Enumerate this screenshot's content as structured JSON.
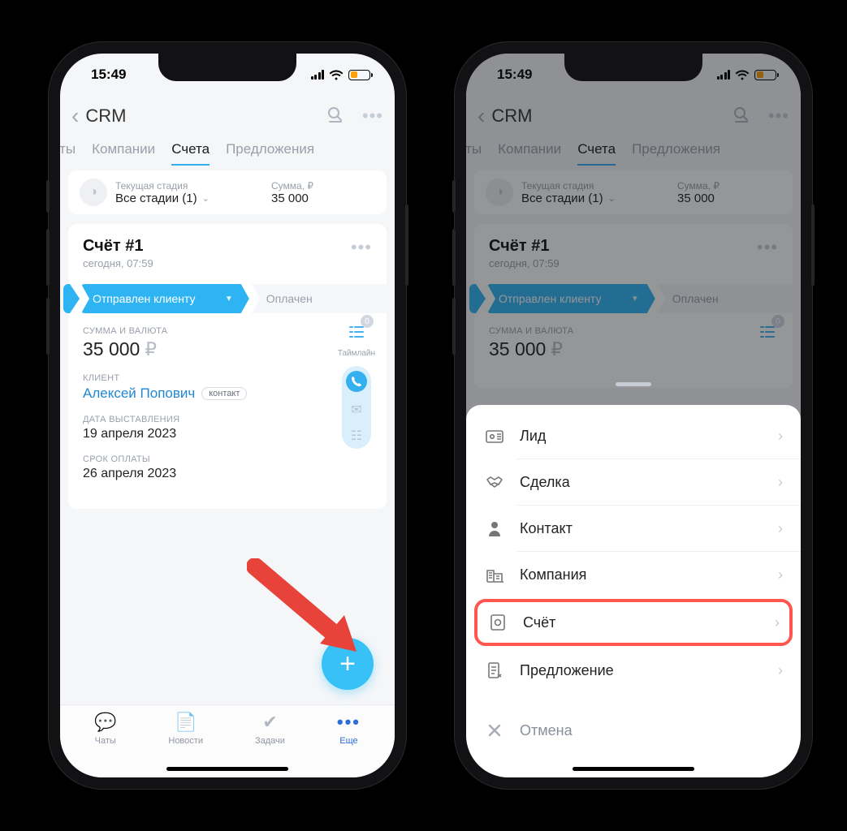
{
  "status": {
    "time": "15:49"
  },
  "nav": {
    "title": "CRM"
  },
  "tabs": {
    "t0": "акты",
    "t1": "Компании",
    "t2": "Счета",
    "t3": "Предложения"
  },
  "filter": {
    "stage_label": "Текущая стадия",
    "stage_value": "Все стадии (1)",
    "sum_label": "Сумма, ₽",
    "sum_value": "35 000"
  },
  "card": {
    "title": "Счёт #1",
    "subtitle": "сегодня, 07:59",
    "stage_current": "Отправлен клиенту",
    "stage_next": "Оплачен",
    "sum_label": "СУММА И ВАЛЮТА",
    "sum_value": "35 000",
    "sum_cur": "₽",
    "client_label": "КЛИЕНТ",
    "client_name": "Алексей Попович",
    "client_tag": "контакт",
    "date1_label": "ДАТА ВЫСТАВЛЕНИЯ",
    "date1_value": "19 апреля 2023",
    "date2_label": "СРОК ОПЛАТЫ",
    "date2_value": "26 апреля 2023",
    "timeline_badge": "0",
    "timeline_label": "Таймлайн"
  },
  "tabbar": {
    "t0": "Чаты",
    "t1": "Новости",
    "t2": "Задачи",
    "t3": "Еще"
  },
  "sheet": {
    "i0": "Лид",
    "i1": "Сделка",
    "i2": "Контакт",
    "i3": "Компания",
    "i4": "Счёт",
    "i5": "Предложение",
    "cancel": "Отмена"
  }
}
